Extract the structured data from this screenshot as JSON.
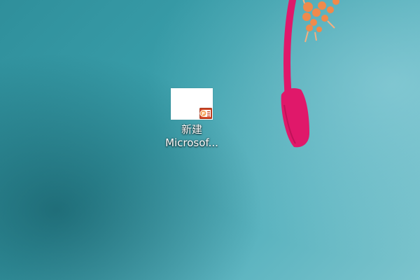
{
  "desktop": {
    "icons": [
      {
        "label_line1": "新建",
        "label_line2": "Microsof...",
        "icon": "powerpoint-file-icon"
      }
    ]
  },
  "colors": {
    "wallpaper_teal": "#3a9fab",
    "flower_pink": "#e0186a",
    "flower_orange": "#f08a4b",
    "ppt_orange": "#d24726"
  }
}
